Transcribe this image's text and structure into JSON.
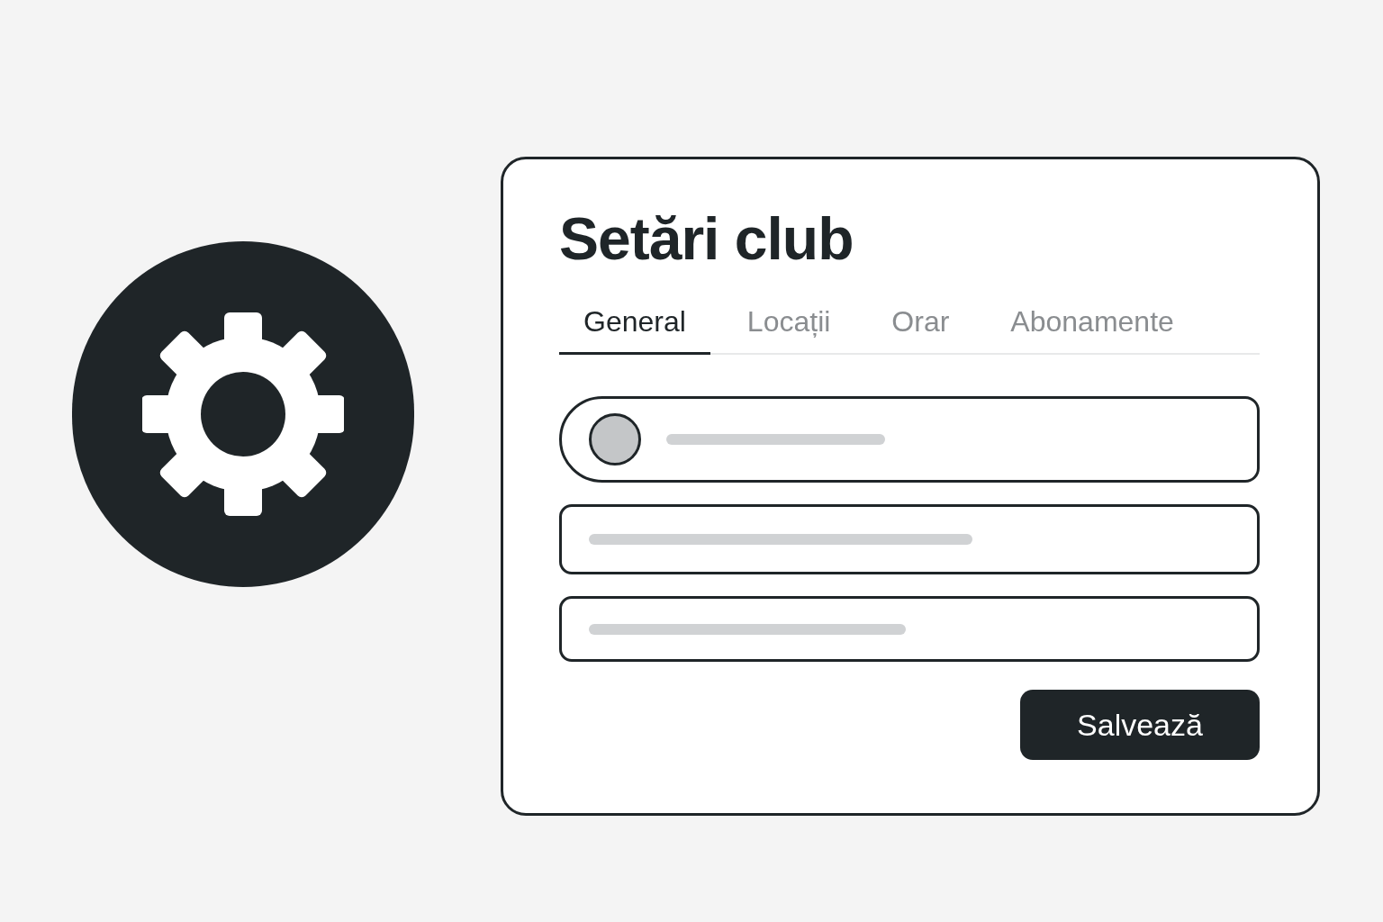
{
  "title": "Setări club",
  "tabs": [
    {
      "label": "General",
      "selected": true
    },
    {
      "label": "Locații",
      "selected": false
    },
    {
      "label": "Orar",
      "selected": false
    },
    {
      "label": "Abonamente",
      "selected": false
    }
  ],
  "fields": [
    {
      "kind": "avatar"
    },
    {
      "kind": "line"
    },
    {
      "kind": "line"
    }
  ],
  "save_button": "Salvează"
}
